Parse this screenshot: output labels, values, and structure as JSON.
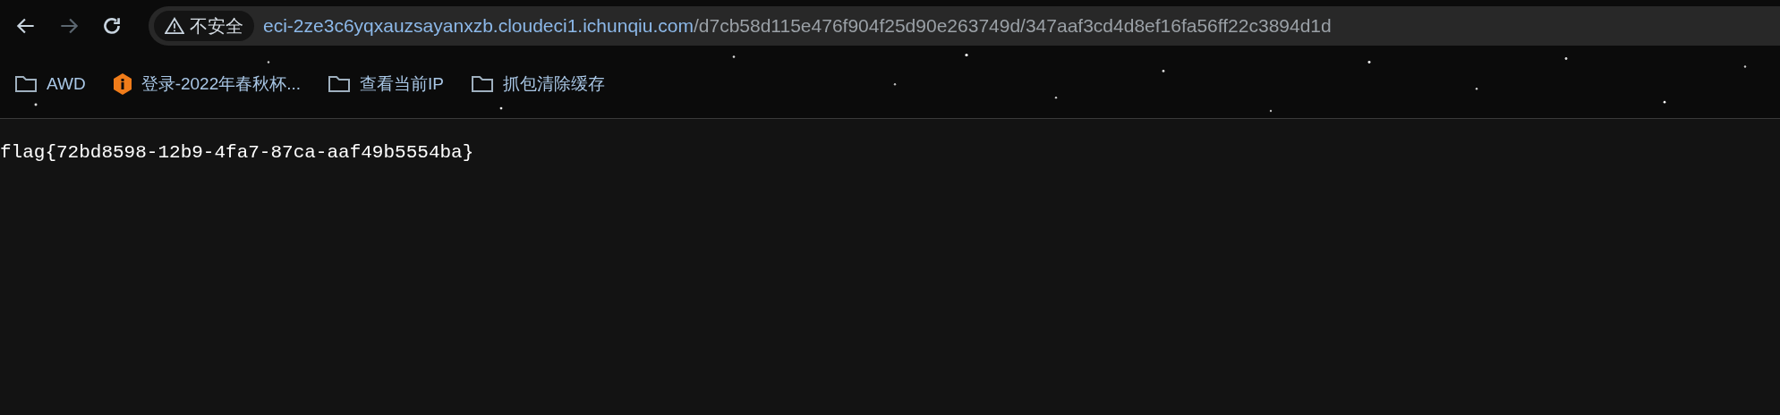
{
  "toolbar": {
    "security_label": "不安全",
    "url_host": "eci-2ze3c6yqxauzsayanxzb.cloudeci1.ichunqiu.com",
    "url_path": "/d7cb58d115e476f904f25d90e263749d/347aaf3cd4d8ef16fa56ff22c3894d1d"
  },
  "bookmarks": [
    {
      "kind": "folder",
      "label": "AWD"
    },
    {
      "kind": "site",
      "label": "登录-2022年春秋杯..."
    },
    {
      "kind": "folder",
      "label": "查看当前IP"
    },
    {
      "kind": "folder",
      "label": "抓包清除缓存"
    }
  ],
  "page": {
    "text": "flag{72bd8598-12b9-4fa7-87ca-aaf49b5554ba}"
  }
}
